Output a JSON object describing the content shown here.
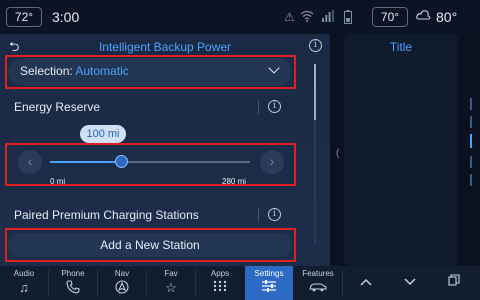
{
  "status_bar": {
    "outside_temp": "72°",
    "time": "3:00",
    "cabin_temp": "70°",
    "climate_temp": "80°",
    "icons": [
      "no-signal-icon",
      "wifi-icon",
      "signal-bars-icon",
      "battery-icon",
      "climate-icon"
    ]
  },
  "main": {
    "title": "Intelligent Backup Power",
    "selection_label": "Selection:",
    "selection_value": "Automatic",
    "energy_reserve_label": "Energy Reserve",
    "slider": {
      "value_label": "100 mi",
      "value": 100,
      "min": 0,
      "max": 280,
      "min_label": "0 mi",
      "max_label": "280 mi"
    },
    "paired_label": "Paired Premium Charging Stations",
    "add_station_label": "Add a New Station"
  },
  "side_panel": {
    "title": "Title"
  },
  "nav": {
    "items": [
      {
        "label": "Audio",
        "icon": "music-note-icon"
      },
      {
        "label": "Phone",
        "icon": "phone-icon"
      },
      {
        "label": "Nav",
        "icon": "navigation-icon"
      },
      {
        "label": "Fav",
        "icon": "star-icon"
      },
      {
        "label": "Apps",
        "icon": "apps-grid-icon"
      },
      {
        "label": "Settings",
        "icon": "sliders-icon"
      },
      {
        "label": "Features",
        "icon": "car-icon"
      }
    ],
    "active": "Settings",
    "colors": {
      "accent": "#2d6ac4",
      "highlight": "#e02020",
      "title_blue": "#4aa3ff"
    }
  }
}
